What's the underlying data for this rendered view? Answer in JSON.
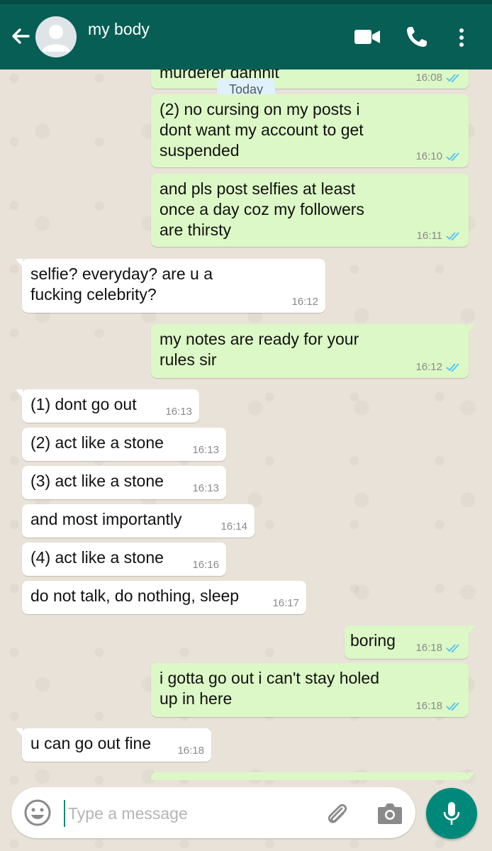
{
  "header": {
    "contact_name": "my body"
  },
  "date_chip": "Today",
  "messages": [
    {
      "dir": "out",
      "text": "murderer damnit",
      "time": "16:08",
      "ticks": true
    },
    {
      "dir": "out",
      "text": "(2) no cursing on my posts i\ndont want my account to get\nsuspended",
      "time": "16:10",
      "ticks": true
    },
    {
      "dir": "out",
      "text": "and pls post selfies at least\nonce a day coz my followers\nare thirsty",
      "time": "16:11",
      "ticks": true
    },
    {
      "dir": "in",
      "text": "selfie? everyday? are u a\nfucking celebrity?",
      "time": "16:12"
    },
    {
      "dir": "out",
      "text": "my notes are ready for your\nrules sir",
      "time": "16:12",
      "ticks": true
    },
    {
      "dir": "in",
      "text": "(1) dont go out",
      "time": "16:13"
    },
    {
      "dir": "in",
      "text": "(2) act like a stone",
      "time": "16:13"
    },
    {
      "dir": "in",
      "text": "(3) act like a stone",
      "time": "16:13"
    },
    {
      "dir": "in",
      "text": "and most importantly",
      "time": "16:14"
    },
    {
      "dir": "in",
      "text": "(4) act like a stone",
      "time": "16:16"
    },
    {
      "dir": "in",
      "text": "do not talk, do nothing, sleep",
      "time": "16:17"
    },
    {
      "dir": "out",
      "text": "boring",
      "time": "16:18",
      "ticks": true
    },
    {
      "dir": "out",
      "text": "i gotta go out i can't stay holed\nup in here",
      "time": "16:18",
      "ticks": true
    },
    {
      "dir": "in",
      "text": "u can go out fine",
      "time": "16:18"
    }
  ],
  "composer": {
    "placeholder": "Type a message"
  },
  "colors": {
    "header": "#075e54",
    "outgoing_bubble": "#dcf8c6",
    "incoming_bubble": "#ffffff",
    "read_ticks": "#4fc3f7",
    "mic_button": "#00897b"
  },
  "icons": [
    "back-arrow-icon",
    "avatar-placeholder-icon",
    "video-call-icon",
    "phone-call-icon",
    "more-menu-icon",
    "emoji-icon",
    "attach-icon",
    "camera-icon",
    "mic-icon",
    "double-tick-icon"
  ]
}
